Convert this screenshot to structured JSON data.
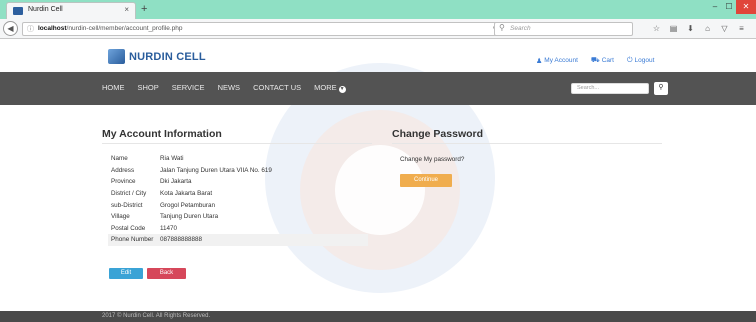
{
  "browser": {
    "tab_title": "Nurdin Cell",
    "tab_close": "×",
    "new_tab": "+",
    "url_host": "localhost",
    "url_path": "/nurdin-cell/member/account_profile.php",
    "search_placeholder": "Search",
    "window_minimize": "–",
    "window_maximize": "☐",
    "window_close": "✕"
  },
  "site": {
    "logo_text": "NURDIN CELL",
    "top_links": [
      {
        "icon": "user-icon",
        "label": "My Account"
      },
      {
        "icon": "cart-icon",
        "label": "Cart"
      },
      {
        "icon": "power-icon",
        "label": "Logout"
      }
    ],
    "menu": [
      "HOME",
      "SHOP",
      "SERVICE",
      "NEWS",
      "CONTACT US",
      "MORE"
    ],
    "search_placeholder": "Search..."
  },
  "account": {
    "title": "My Account Information",
    "rows": [
      {
        "label": "Name",
        "value": "Ria Wati"
      },
      {
        "label": "Address",
        "value": "Jalan Tanjung Duren Utara VIIA No. 619"
      },
      {
        "label": "Province",
        "value": "Dki Jakarta"
      },
      {
        "label": "District / City",
        "value": "Kota Jakarta Barat"
      },
      {
        "label": "sub-District",
        "value": "Grogol Petamburan"
      },
      {
        "label": "Village",
        "value": "Tanjung Duren Utara"
      },
      {
        "label": "Postal Code",
        "value": "11470"
      },
      {
        "label": "Phone Number",
        "value": "087888888888"
      }
    ],
    "edit_label": "Edit",
    "back_label": "Back"
  },
  "password": {
    "title": "Change Password",
    "prompt": "Change My password?",
    "continue_label": "Continue"
  },
  "footer": {
    "text": "2017 © Nurdin Cell. All Rights Reserved."
  },
  "colors": {
    "nav_bg": "#535353",
    "accent_blue": "#3aa3d6",
    "danger": "#d6475a",
    "warning": "#f0ad4e",
    "brand": "#2a5d9c",
    "tab_strip": "#8fe0c4"
  }
}
